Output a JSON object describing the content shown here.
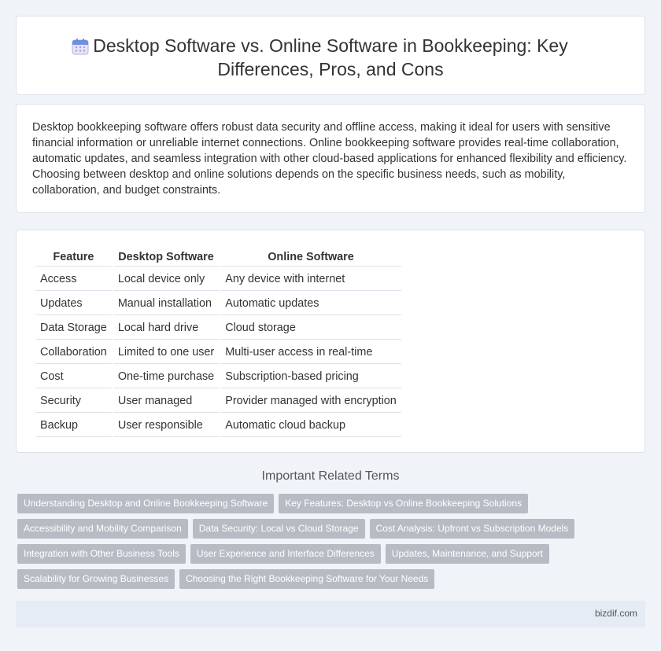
{
  "header": {
    "icon": "calendar-icon",
    "title": "Desktop Software vs. Online Software in Bookkeeping: Key Differences, Pros, and Cons"
  },
  "intro": "Desktop bookkeeping software offers robust data security and offline access, making it ideal for users with sensitive financial information or unreliable internet connections. Online bookkeeping software provides real-time collaboration, automatic updates, and seamless integration with other cloud-based applications for enhanced flexibility and efficiency. Choosing between desktop and online solutions depends on the specific business needs, such as mobility, collaboration, and budget constraints.",
  "table": {
    "headers": [
      "Feature",
      "Desktop Software",
      "Online Software"
    ],
    "rows": [
      [
        "Access",
        "Local device only",
        "Any device with internet"
      ],
      [
        "Updates",
        "Manual installation",
        "Automatic updates"
      ],
      [
        "Data Storage",
        "Local hard drive",
        "Cloud storage"
      ],
      [
        "Collaboration",
        "Limited to one user",
        "Multi-user access in real-time"
      ],
      [
        "Cost",
        "One-time purchase",
        "Subscription-based pricing"
      ],
      [
        "Security",
        "User managed",
        "Provider managed with encryption"
      ],
      [
        "Backup",
        "User responsible",
        "Automatic cloud backup"
      ]
    ]
  },
  "related": {
    "title": "Important Related Terms",
    "tags": [
      "Understanding Desktop and Online Bookkeeping Software",
      "Key Features: Desktop vs Online Bookkeeping Solutions",
      "Accessibility and Mobility Comparison",
      "Data Security: Local vs Cloud Storage",
      "Cost Analysis: Upfront vs Subscription Models",
      "Integration with Other Business Tools",
      "User Experience and Interface Differences",
      "Updates, Maintenance, and Support",
      "Scalability for Growing Businesses",
      "Choosing the Right Bookkeeping Software for Your Needs"
    ]
  },
  "footer": {
    "site": "bizdif.com"
  }
}
